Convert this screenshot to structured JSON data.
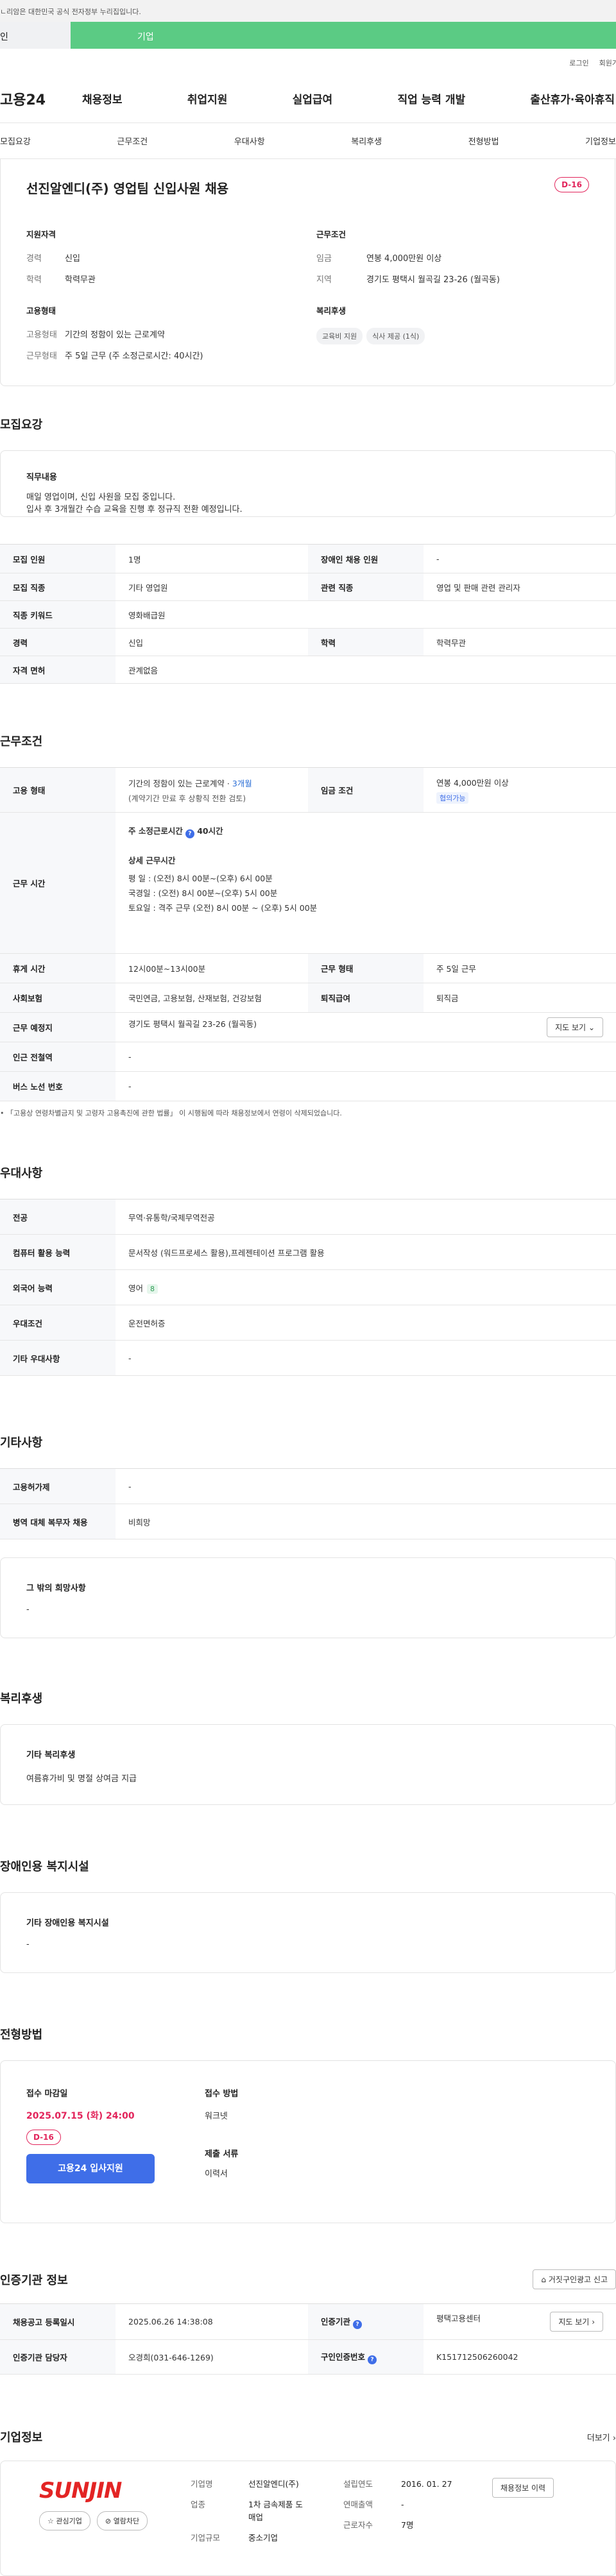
{
  "gov_banner": "ㄴ리암은 대한민국 공식 전자정부 누리집입니다.",
  "site_tabs": {
    "personal": "인",
    "business": "기업"
  },
  "util": {
    "login": "로그인",
    "join": "회원가"
  },
  "logo": "고용24",
  "gnb": [
    "채용정보",
    "취업지원",
    "실업급여",
    "직업 능력 개발",
    "출산휴가·육아휴직"
  ],
  "subtabs": [
    "모집요강",
    "근무조건",
    "우대사항",
    "복리후생",
    "전형방법",
    "기업정보"
  ],
  "summary": {
    "title": "선진알엔디(주) 영업팀 신입사원 채용",
    "dday": "D-16",
    "qual_title": "지원자격",
    "career_k": "경력",
    "career_v": "신입",
    "edu_k": "학력",
    "edu_v": "학력무관",
    "cond_title": "근무조건",
    "wage_k": "임금",
    "wage_v": "연봉 4,000만원 이상",
    "area_k": "지역",
    "area_v": "경기도 평택시 월곡길 23-26 (월곡동)",
    "emp_title": "고용형태",
    "emp_k": "고용형태",
    "emp_v": "기간의 정함이 있는 근로계약",
    "work_k": "근무형태",
    "work_v": "주 5일 근무 (주 소정근로시간: 40시간)",
    "welfare_title": "복리후생",
    "chips": [
      "교육비 지원",
      "식사 제공 (1식)"
    ]
  },
  "recruit": {
    "title": "모집요강",
    "duty_h": "직무내용",
    "duty_p1": "매일 영업이며, 신입 사원을 모집 중입니다.",
    "duty_p2": "입사 후 3개월간 수습 교육을 진행 후 정규직 전환 예정입니다.",
    "rows": [
      [
        "모집 인원",
        "1명",
        "장애인 채용 인원",
        "-"
      ],
      [
        "모집 직종",
        "기타 영업원",
        "관련 직종",
        "영업 및 판매 관련 관리자"
      ],
      [
        "직종 키워드",
        "영화배급원",
        "",
        ""
      ],
      [
        "경력",
        "신입",
        "학력",
        "학력무관"
      ],
      [
        "자격 면허",
        "관계없음",
        "",
        ""
      ]
    ]
  },
  "conditions": {
    "title": "근무조건",
    "emp_k": "고용 형태",
    "emp_v1": "기간의 정함이 있는 근로계약 · ",
    "emp_v1b": "3개월",
    "emp_v2": "(계약기간 만료 후 상황직 전환 검토)",
    "wage_k": "임금 조건",
    "wage_v": "연봉 4,000만원 이상",
    "wage_tag": "협의가능",
    "hours_k": "근무 시간",
    "hours_h": "주 소정근로시간",
    "hours_hv": "40시간",
    "detail_h": "상세 근무시간",
    "detail_1": "평    일 : (오전) 8시 00분~(오후) 6시 00분",
    "detail_2": "국경일 : (오전) 8시 00분~(오후) 5시 00분",
    "detail_3": "토요일 : 격주 근무 (오전) 8시 00분 ~ (오후) 5시 00분",
    "rest_k": "휴게 시간",
    "rest_v": "12시00분~13시00분",
    "worktype_k": "근무 형태",
    "worktype_v": "주 5일 근무",
    "ins_k": "사회보험",
    "ins_v": "국민연금, 고용보험, 산재보험, 건강보험",
    "sev_k": "퇴직급여",
    "sev_v": "퇴직금",
    "loc_k": "근무 예정지",
    "loc_v": "경기도 평택시 월곡길 23-26 (월곡동)",
    "map_btn": "지도 보기",
    "subway_k": "인근 전철역",
    "subway_v": "-",
    "bus_k": "버스 노선 번호",
    "bus_v": "-",
    "note": "• 「고용상 연령차별금지 및 고령자 고용촉진에 관한 법률」 이 시행됨에 따라 채용정보에서 연령이 삭제되었습니다."
  },
  "preference": {
    "title": "우대사항",
    "rows": [
      [
        "전공",
        "무역·유통학/국제무역전공"
      ],
      [
        "컴퓨터 활용 능력",
        "문서작성 (워드프로세스 활용),프레젠테이션 프로그램 활용"
      ],
      [
        "외국어 능력",
        "영어"
      ],
      [
        "우대조건",
        "운전면허증"
      ],
      [
        "기타 우대사항",
        "-"
      ]
    ],
    "lang_level": "8"
  },
  "other": {
    "title": "기타사항",
    "rows": [
      [
        "고용허가제",
        "-"
      ],
      [
        "병역 대체 복무자 채용",
        "비희망"
      ]
    ],
    "box_h": "그 밖의 희망사항",
    "box_p": "-"
  },
  "welfare": {
    "title": "복리후생",
    "box_h": "기타 복리후생",
    "box_p": "여름휴가비 및 명절 상여금 지급"
  },
  "disabled": {
    "title": "장애인용 복지시설",
    "box_h": "기타 장애인용 복지시설",
    "box_p": "-"
  },
  "process": {
    "title": "전형방법",
    "deadline_h": "접수 마감일",
    "deadline": "2025.07.15 (화) 24:00",
    "dday": "D-16",
    "apply": "고용24 입사지원",
    "method_h": "접수 방법",
    "method_v": "워크넷",
    "docs_h": "제출 서류",
    "docs_v": "이력서"
  },
  "cert": {
    "title": "인증기관 정보",
    "report_btn": "거짓구인광고 신고",
    "reg_k": "채용공고 등록일시",
    "reg_v": "2025.06.26 14:38:08",
    "agency_k": "인증기관",
    "agency_v": "평택고용센터",
    "map_btn": "지도 보기",
    "mgr_k": "인증기관 담당자",
    "mgr_v": "오경희(031-646-1269)",
    "cert_k": "구인인증번호",
    "cert_v": "K151712506260042"
  },
  "company": {
    "title": "기업정보",
    "more": "더보기",
    "logo_text": "SUNJIN",
    "fav": "관심기업",
    "block": "열람차단",
    "name_k": "기업명",
    "name_v": "선진알엔디(주)",
    "ind_k": "업종",
    "ind_v1": "1차 금속제품 도",
    "ind_v2": "매업",
    "size_k": "기업규모",
    "size_v": "중소기업",
    "year_k": "설립연도",
    "year_v": "2016. 01. 27",
    "sales_k": "연매출액",
    "sales_v": "-",
    "emp_k": "근로자수",
    "emp_v": "7명",
    "history_btn": "채용정보 이력"
  }
}
